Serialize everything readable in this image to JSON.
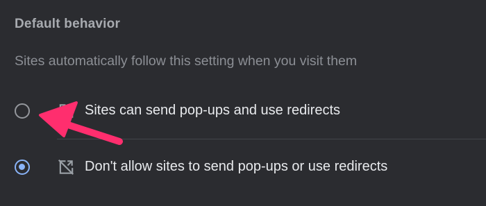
{
  "section": {
    "title": "Default behavior",
    "description": "Sites automatically follow this setting when you visit them"
  },
  "options": [
    {
      "label": "Sites can send pop-ups and use redirects",
      "icon": "popup-allowed-icon",
      "selected": false
    },
    {
      "label": "Don't allow sites to send pop-ups or use redirects",
      "icon": "popup-blocked-icon",
      "selected": true
    }
  ],
  "colors": {
    "background": "#2b2c30",
    "accent": "#8ab4f8",
    "annotation_arrow": "#ff2e6e"
  }
}
